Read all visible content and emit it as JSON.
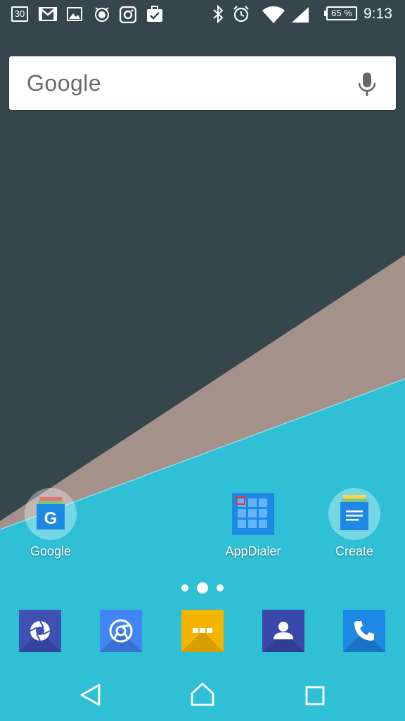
{
  "status_bar": {
    "calendar_day": "30",
    "battery_percent": "65 %",
    "time": "9:13",
    "icons": [
      "calendar-icon",
      "gmail-icon",
      "gallery-icon",
      "alarm-app-icon",
      "instagram-icon",
      "tasks-icon",
      "bluetooth-icon",
      "alarm-icon",
      "wifi-icon",
      "signal-icon",
      "battery-icon"
    ]
  },
  "search": {
    "logo_text": "Google",
    "mic_icon": "mic-icon"
  },
  "home_apps": [
    {
      "label": "Google",
      "icon": "google-folder-icon"
    },
    {
      "label": "AppDialer",
      "icon": "appdialer-icon"
    },
    {
      "label": "Create",
      "icon": "create-folder-icon"
    }
  ],
  "page_indicator": {
    "pages": 3,
    "current": 2
  },
  "dock": [
    {
      "icon": "camera-aperture-icon",
      "color": "#3F51B5"
    },
    {
      "icon": "chrome-icon",
      "color": "#4285F4"
    },
    {
      "icon": "app-drawer-icon",
      "color": "#F4B400"
    },
    {
      "icon": "contacts-icon",
      "color": "#3949AB"
    },
    {
      "icon": "phone-icon",
      "color": "#1E88E5"
    }
  ],
  "nav": {
    "back": "back-icon",
    "home": "home-icon",
    "recents": "recents-icon"
  },
  "colors": {
    "wallpaper_dark": "#35474C",
    "wallpaper_taupe": "#A3918A",
    "wallpaper_cyan": "#2FC0D6"
  }
}
